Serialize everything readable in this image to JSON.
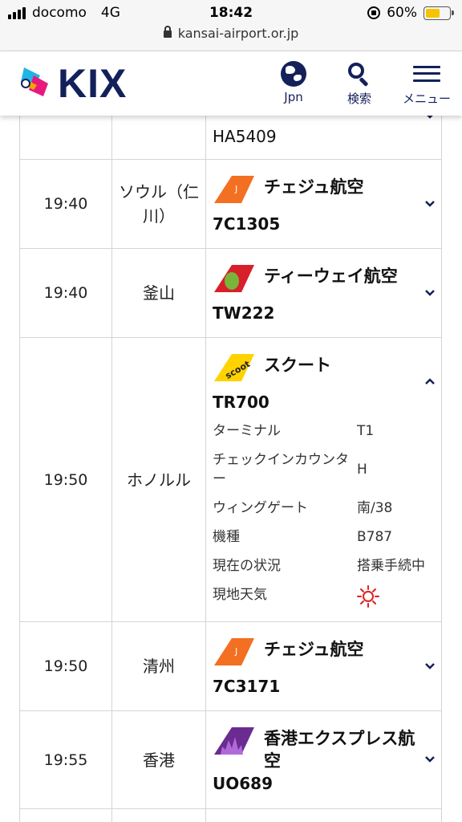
{
  "status_bar": {
    "carrier": "docomo",
    "network": "4G",
    "time": "18:42",
    "battery": "60%",
    "battery_level": 0.6,
    "url": "kansai-airport.or.jp"
  },
  "header": {
    "logo_text": "KIX",
    "language_label": "Jpn",
    "search_label": "検索",
    "menu_label": "メニュー",
    "brand_color": "#13205a"
  },
  "flights": [
    {
      "time": "",
      "destination": "",
      "airline": "",
      "flight_no": "HA5409",
      "expanded": false
    },
    {
      "time": "19:40",
      "destination": "ソウル（仁川）",
      "airline": "チェジュ航空",
      "flight_no": "7C1305",
      "logo": "jejuair-tail-icon",
      "expanded": false
    },
    {
      "time": "19:40",
      "destination": "釜山",
      "airline": "ティーウェイ航空",
      "flight_no": "TW222",
      "logo": "tway-tail-icon",
      "expanded": false
    },
    {
      "time": "19:50",
      "destination": "ホノルル",
      "airline": "スクート",
      "flight_no": "TR700",
      "logo": "scoot-tail-icon",
      "expanded": true,
      "details": [
        {
          "key": "ターミナル",
          "value": "T1"
        },
        {
          "key": "チェックインカウンター",
          "value": "H"
        },
        {
          "key": "ウィングゲート",
          "value": "南/38"
        },
        {
          "key": "機種",
          "value": "B787"
        },
        {
          "key": "現在の状況",
          "value": "搭乗手続中"
        },
        {
          "key": "現地天気",
          "value": "",
          "icon": "sun-icon"
        }
      ]
    },
    {
      "time": "19:50",
      "destination": "清州",
      "airline": "チェジュ航空",
      "flight_no": "7C3171",
      "logo": "jejuair-tail-icon",
      "expanded": false
    },
    {
      "time": "19:55",
      "destination": "香港",
      "airline": "香港エクスプレス航空",
      "flight_no": "UO689",
      "logo": "hkexpress-tail-icon",
      "expanded": false
    }
  ]
}
